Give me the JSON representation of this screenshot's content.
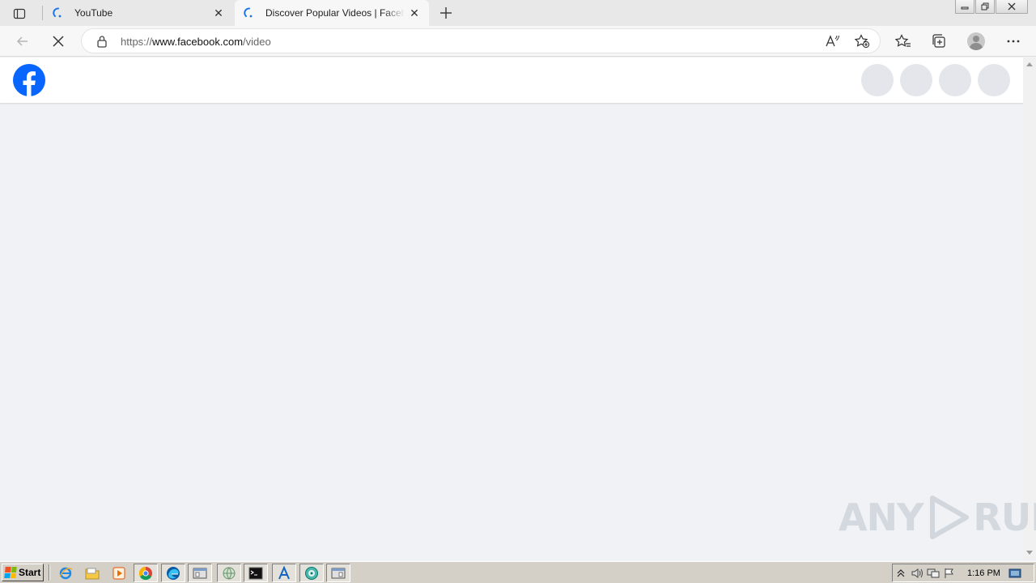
{
  "browser": {
    "tabs": [
      {
        "title": "YouTube",
        "active": false
      },
      {
        "title": "Discover Popular Videos | Facebook",
        "active": true
      }
    ],
    "address": {
      "url_prefix": "https://",
      "url_host": "www.facebook.com",
      "url_path": "/video"
    }
  },
  "watermark": {
    "left": "ANY",
    "right": "RUN"
  },
  "taskbar": {
    "start_label": "Start",
    "clock": "1:16 PM"
  }
}
